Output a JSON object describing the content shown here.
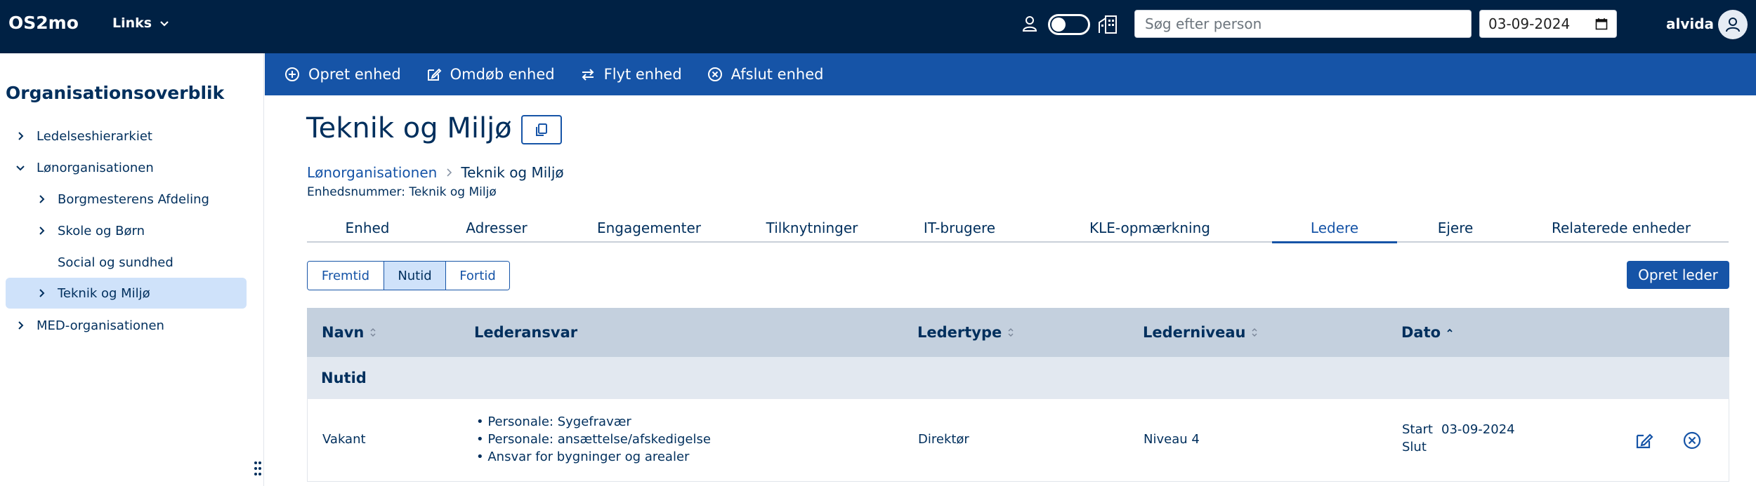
{
  "app": {
    "brand": "OS2mo",
    "links_label": "Links",
    "search_placeholder": "Søg efter person",
    "date_value": "03-09-2024",
    "user_name": "alvida"
  },
  "sidebar": {
    "title": "Organisationsoverblik",
    "items": [
      {
        "label": "Ledelseshierarkiet"
      },
      {
        "label": "Lønorganisationen"
      },
      {
        "label": "Borgmesterens Afdeling"
      },
      {
        "label": "Skole og Børn"
      },
      {
        "label": "Social og sundhed"
      },
      {
        "label": "Teknik og Miljø"
      },
      {
        "label": "MED-organisationen"
      }
    ]
  },
  "actions": [
    {
      "label": "Opret enhed",
      "icon": "plus-circle-icon"
    },
    {
      "label": "Omdøb enhed",
      "icon": "edit-icon"
    },
    {
      "label": "Flyt enhed",
      "icon": "arrows-swap-icon"
    },
    {
      "label": "Afslut enhed",
      "icon": "x-circle-icon"
    }
  ],
  "page": {
    "title": "Teknik og Miljø",
    "breadcrumb": [
      "Lønorganisationen",
      "Teknik og Miljø"
    ],
    "unit_number": "Enhedsnummer: Teknik og Miljø"
  },
  "tabs": [
    {
      "label": "Enhed"
    },
    {
      "label": "Adresser"
    },
    {
      "label": "Engagementer"
    },
    {
      "label": "Tilknytninger"
    },
    {
      "label": "IT-brugere"
    },
    {
      "label": "KLE-opmærkning"
    },
    {
      "label": "Ledere",
      "active": true
    },
    {
      "label": "Ejere"
    },
    {
      "label": "Relaterede enheder"
    }
  ],
  "time_filter": [
    "Fremtid",
    "Nutid",
    "Fortid"
  ],
  "time_filter_selected": "Nutid",
  "create_button": "Opret leder",
  "table": {
    "columns": [
      "Navn",
      "Lederansvar",
      "Ledertype",
      "Lederniveau",
      "Dato"
    ],
    "group_label": "Nutid",
    "rows": [
      {
        "name": "Vakant",
        "responsibilities": [
          "Personale: Sygefravær",
          "Personale: ansættelse/afskedigelse",
          "Ansvar for bygninger og arealer"
        ],
        "type": "Direktør",
        "level": "Niveau 4",
        "start_label": "Start",
        "start_value": "03-09-2024",
        "end_label": "Slut",
        "end_value": ""
      }
    ]
  },
  "colors": {
    "topbar": "#002144",
    "actionbar": "#1654a7",
    "accent": "#1654a7",
    "selected": "#cfe2fa",
    "table_header": "#c4d0de",
    "group_row": "#e2e8f0"
  }
}
